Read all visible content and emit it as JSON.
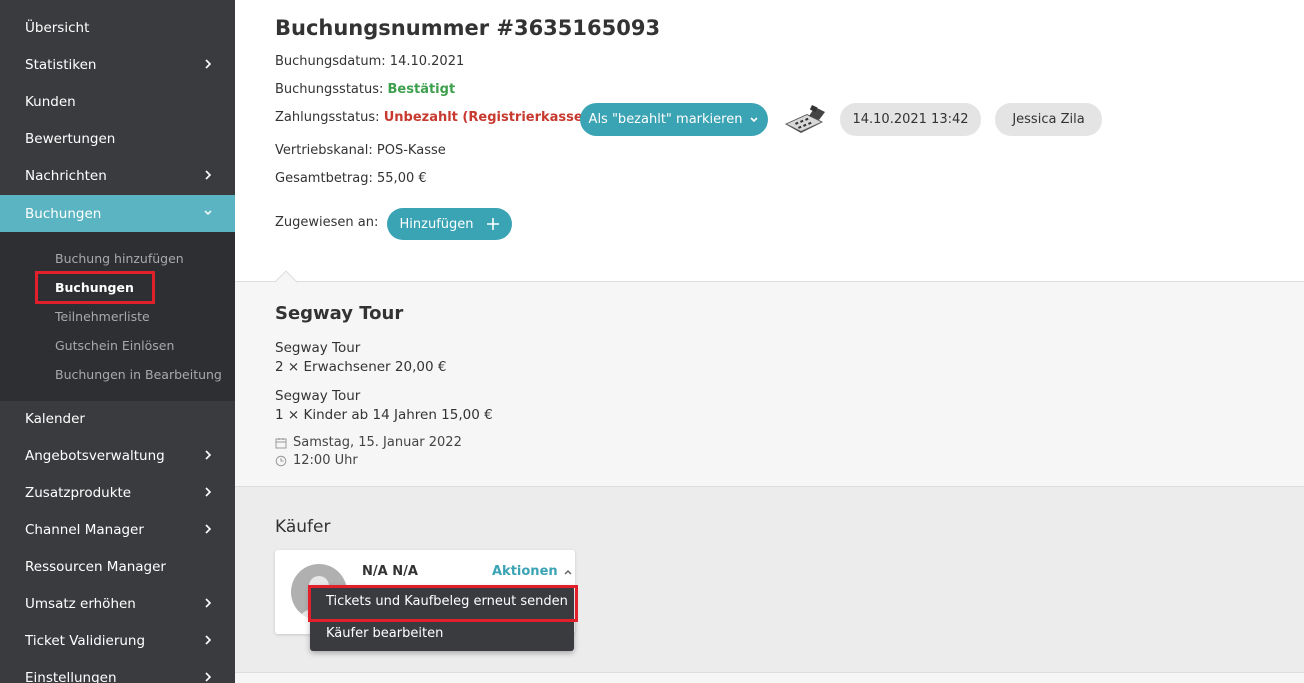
{
  "sidebar": {
    "items": [
      {
        "label": "Übersicht",
        "has_chevron": false
      },
      {
        "label": "Statistiken",
        "has_chevron": true
      },
      {
        "label": "Kunden",
        "has_chevron": false
      },
      {
        "label": "Bewertungen",
        "has_chevron": false
      },
      {
        "label": "Nachrichten",
        "has_chevron": true
      },
      {
        "label": "Buchungen",
        "has_chevron": true,
        "expanded": true
      },
      {
        "label": "Kalender",
        "has_chevron": false
      },
      {
        "label": "Angebotsverwaltung",
        "has_chevron": true
      },
      {
        "label": "Zusatzprodukte",
        "has_chevron": true
      },
      {
        "label": "Channel Manager",
        "has_chevron": true
      },
      {
        "label": "Ressourcen Manager",
        "has_chevron": false
      },
      {
        "label": "Umsatz erhöhen",
        "has_chevron": true
      },
      {
        "label": "Ticket Validierung",
        "has_chevron": true
      },
      {
        "label": "Einstellungen",
        "has_chevron": true
      }
    ],
    "submenu": [
      {
        "label": "Buchung hinzufügen"
      },
      {
        "label": "Buchungen",
        "active": true
      },
      {
        "label": "Teilnehmerliste"
      },
      {
        "label": "Gutschein Einlösen"
      },
      {
        "label": "Buchungen in Bearbeitung"
      }
    ]
  },
  "booking": {
    "title": "Buchungsnummer #3635165093",
    "date_label": "Buchungsdatum:",
    "date_value": "14.10.2021",
    "status_label": "Buchungsstatus:",
    "status_value": "Bestätigt",
    "payment_label": "Zahlungsstatus:",
    "payment_value": "Unbezahlt (Registrierkasse)",
    "mark_paid_button": "Als \"bezahlt\" markieren",
    "timestamp": "14.10.2021 13:42",
    "user": "Jessica Zila",
    "channel_label": "Vertriebskanal:",
    "channel_value": "POS-Kasse",
    "total_label": "Gesamtbetrag:",
    "total_value": "55,00 €",
    "assigned_label": "Zugewiesen an:",
    "add_button": "Hinzufügen"
  },
  "tour": {
    "title": "Segway Tour",
    "lines": [
      {
        "name": "Segway Tour",
        "detail": "2 × Erwachsener 20,00 €"
      },
      {
        "name": "Segway Tour",
        "detail": "1 × Kinder ab 14 Jahren 15,00 €"
      }
    ],
    "date": "Samstag, 15. Januar 2022",
    "time": "12:00 Uhr"
  },
  "buyer": {
    "heading": "Käufer",
    "name": "N/A N/A",
    "actions_label": "Aktionen",
    "actions_menu": [
      {
        "label": "Tickets und Kaufbeleg erneut senden",
        "highlighted": true
      },
      {
        "label": "Käufer bearbeiten"
      }
    ]
  },
  "colors": {
    "sidebar_bg": "#3a3b3f",
    "accent": "#3aa3b4",
    "active_nav": "#5bb4c1",
    "highlight_box": "#e2202b",
    "status_ok": "#3e9f4d",
    "status_unpaid": "#c83a2f"
  }
}
